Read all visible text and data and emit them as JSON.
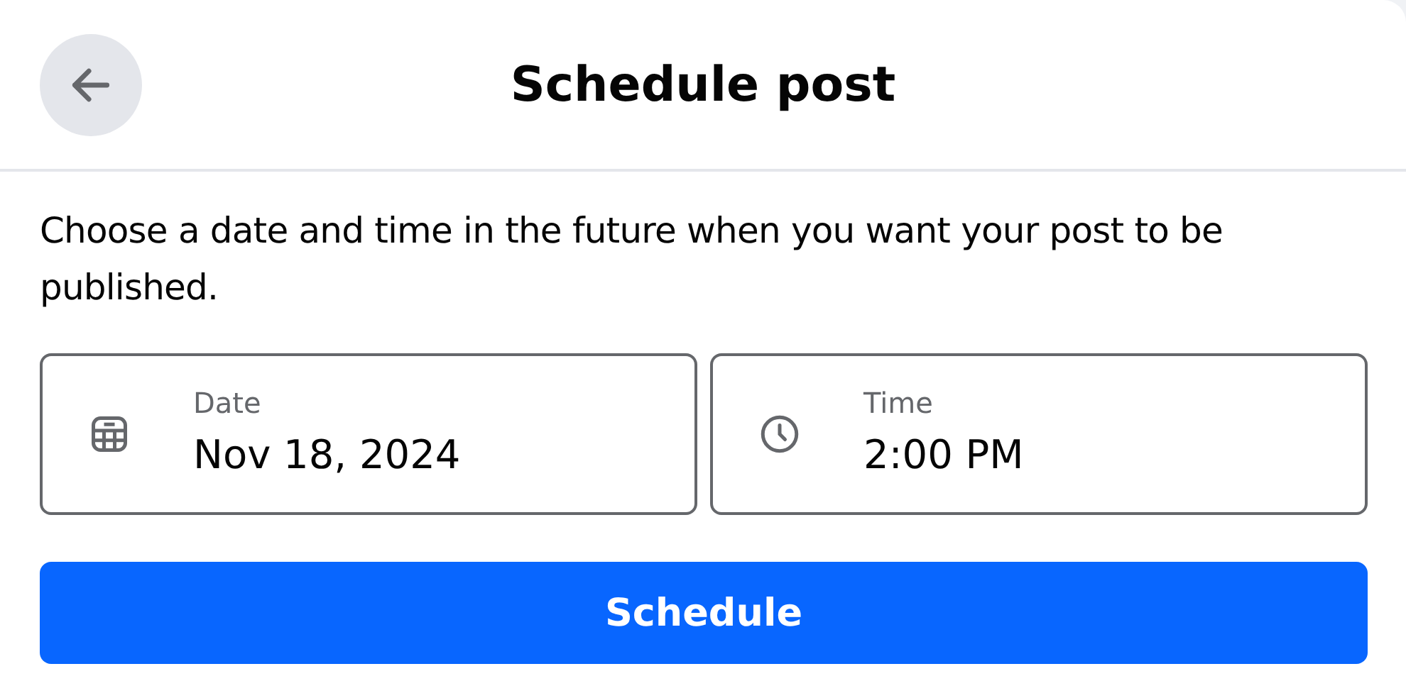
{
  "header": {
    "title": "Schedule post"
  },
  "description": "Choose a date and time in the future when you want your post to be published.",
  "fields": [
    {
      "kind": "date",
      "label": "Date",
      "value": "Nov 18, 2024"
    },
    {
      "kind": "time",
      "label": "Time",
      "value": "2:00 PM"
    }
  ],
  "button": {
    "label": "Schedule"
  }
}
